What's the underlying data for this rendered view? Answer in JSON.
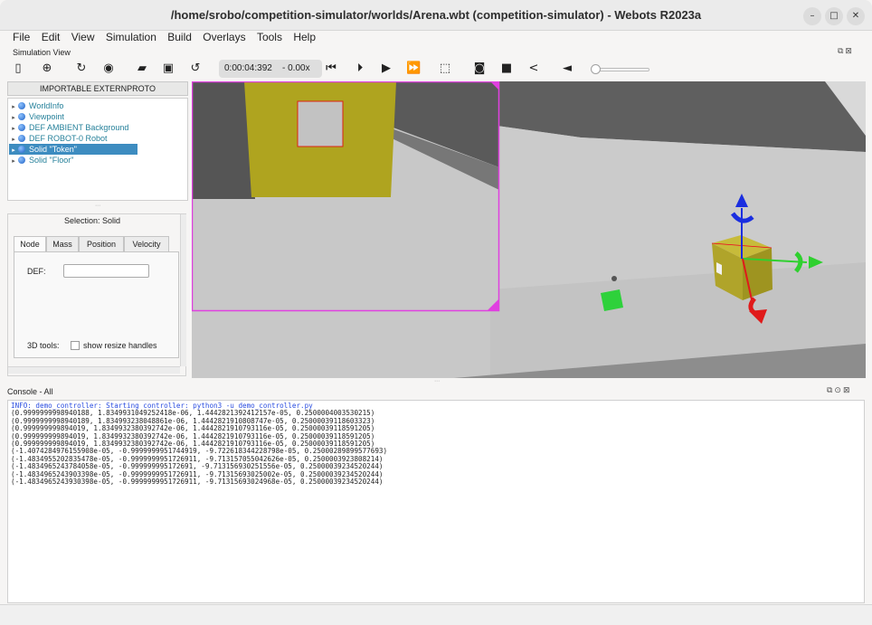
{
  "window": {
    "title": "/home/srobo/competition-simulator/worlds/Arena.wbt (competition-simulator) - Webots R2023a",
    "minimize_icon": "minimize-icon",
    "maximize_icon": "maximize-icon",
    "close_icon": "close-icon"
  },
  "menu": [
    "File",
    "Edit",
    "View",
    "Simulation",
    "Build",
    "Overlays",
    "Tools",
    "Help"
  ],
  "simulation_view": {
    "label": "Simulation View",
    "time": "0:00:04:392",
    "speed": "- 0.00x",
    "toolbar_icons": [
      "scene-tree-toggle-icon",
      "add-node-icon",
      "reload-icon",
      "view-icon",
      "open-world-icon",
      "save-icon",
      "reset-icon",
      "step-back-icon",
      "step-icon",
      "play-icon",
      "fast-forward-icon",
      "box-view-icon",
      "screenshot-icon",
      "record-icon",
      "share-icon",
      "volume-icon"
    ],
    "volume_level": 0.0
  },
  "scene_tree": {
    "import_button": "IMPORTABLE EXTERNPROTO",
    "items": [
      {
        "label": "WorldInfo",
        "selected": false
      },
      {
        "label": "Viewpoint",
        "selected": false
      },
      {
        "label": "DEF AMBIENT Background",
        "selected": false
      },
      {
        "label": "DEF ROBOT-0 Robot",
        "selected": false
      },
      {
        "label": "Solid \"Token\"",
        "selected": true
      },
      {
        "label": "Solid \"Floor\"",
        "selected": false
      }
    ]
  },
  "selection": {
    "title": "Selection: Solid",
    "tabs": [
      "Node",
      "Mass",
      "Position",
      "Velocity"
    ],
    "active_tab": "Node",
    "def_label": "DEF:",
    "def_value": "",
    "tools_label": "3D tools:",
    "resize_label": "show resize handles",
    "resize_checked": false
  },
  "console": {
    "title": "Console - All",
    "lines": [
      {
        "text": "INFO: demo_controller: Starting controller: python3 -u demo_controller.py",
        "kind": "info"
      },
      {
        "text": "(0.9999999998940188, 1.8349931049252418e-06, 1.4442821392412157e-05, 0.2500004003530215)",
        "kind": "out"
      },
      {
        "text": "(0.9999999998940189, 1.834993238048861e-06, 1.4442821910808747e-05, 0.2500003911860332​3)",
        "kind": "out"
      },
      {
        "text": "(0.999999999894019, 1.834993238039274​2e-06, 1.4442821910793116e-05, 0.2500003911859120​5)",
        "kind": "out"
      },
      {
        "text": "(0.999999999894019, 1.834993238039274​2e-06, 1.4442821910793116e-05, 0.2500003911859120​5)",
        "kind": "out"
      },
      {
        "text": "(0.999999999894019, 1.834993238039274​2e-06, 1.4442821910793116e-05, 0.2500003911859120​5)",
        "kind": "out"
      },
      {
        "text": "(-1.4074284976155908e-05, -0.999999995174491​9, -9.72261834422879​8e-05, 0.2500028989957769​3)",
        "kind": "out"
      },
      {
        "text": "(-1.4834955202835478e-05, -0.999999995172691​1, -9.71315705504262​6e-05, 0.2500003923808214)",
        "kind": "out"
      },
      {
        "text": "(-1.4834965243784058e-05, -0.99999999517269​1, -9.71315693025155​6e-05, 0.2500003923452024​4)",
        "kind": "out"
      },
      {
        "text": "(-1.4834965243903398e-05, -0.999999995172691​1, -9.71315693025002e-05, 0.2500003923452024​4)",
        "kind": "out"
      },
      {
        "text": "(-1.4834965243930398e-05, -0.999999995172691​1, -9.71315693024968e-05, 0.2500003923452024​4)",
        "kind": "out"
      }
    ]
  },
  "colors": {
    "token": "#b5ac2a",
    "selection_frame": "#e040e0",
    "tree_selected": "#3d8cc0",
    "arrow_x": "#2fd02f",
    "arrow_y": "#1a2ee0",
    "arrow_z": "#e01a1a"
  }
}
